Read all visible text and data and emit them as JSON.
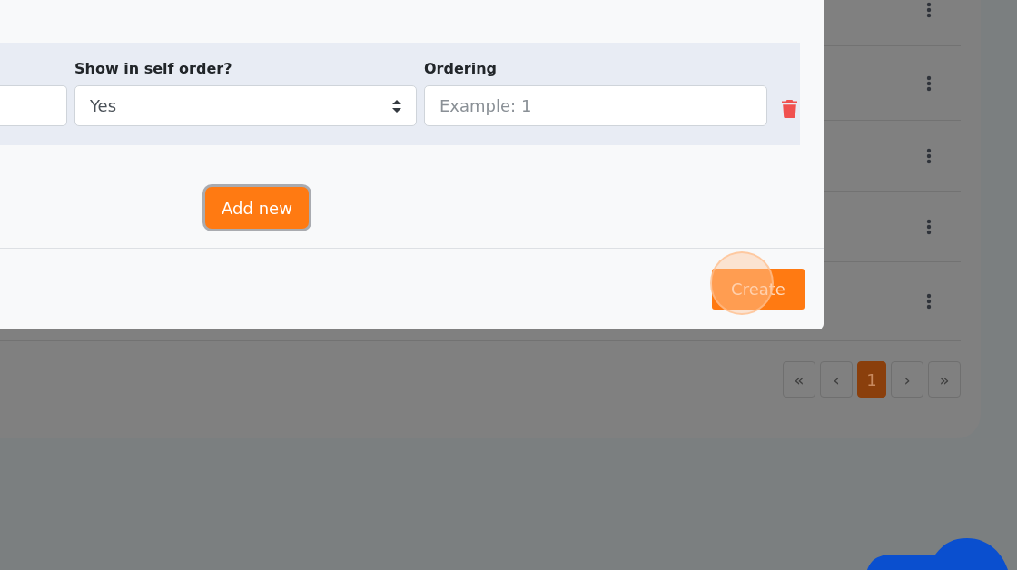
{
  "background_list": {
    "rows": [
      {
        "kind": "menu"
      },
      {
        "kind": "menu"
      },
      {
        "kind": "menu"
      },
      {
        "kind": "menu"
      },
      {
        "kind": "menu"
      }
    ],
    "pagination": [
      {
        "label": "«",
        "selected": false
      },
      {
        "label": "‹",
        "selected": false
      },
      {
        "label": "1",
        "selected": true
      },
      {
        "label": "›",
        "selected": false
      },
      {
        "label": "»",
        "selected": false
      }
    ]
  },
  "modal": {
    "fields": [
      {
        "kind": "input"
      },
      {
        "kind": "select",
        "label": "Show in self order?",
        "value": "Yes"
      },
      {
        "kind": "input",
        "label": "Ordering",
        "placeholder": "Example: 1"
      }
    ],
    "add_button": "Add new",
    "submit_button": "Create"
  }
}
